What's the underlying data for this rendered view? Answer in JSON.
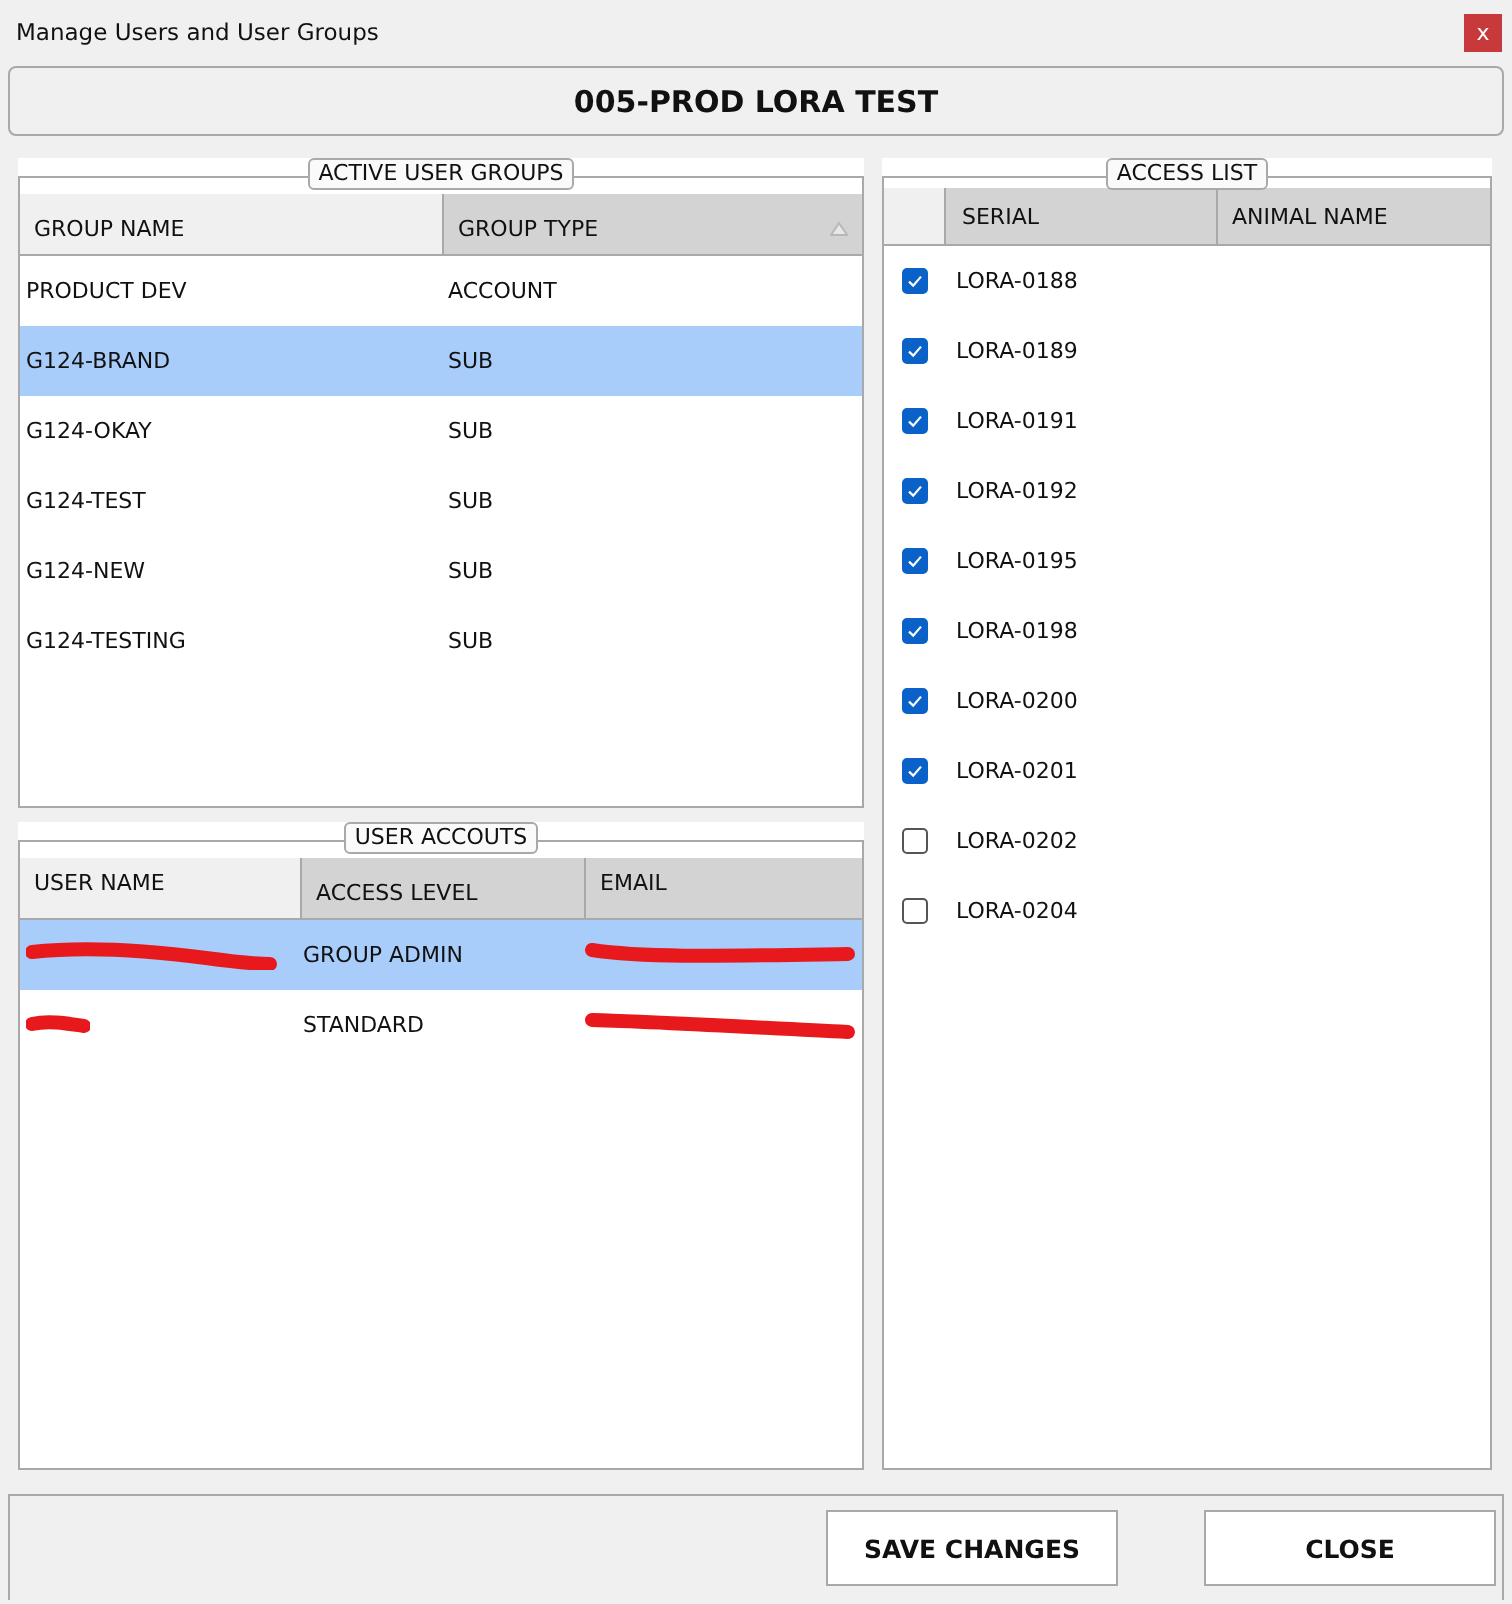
{
  "window": {
    "title": "Manage Users and User Groups",
    "close": "x"
  },
  "heading": "005-PROD LORA TEST",
  "groups": {
    "legend": "ACTIVE USER GROUPS",
    "columns": [
      {
        "label": "GROUP NAME",
        "shaded": false,
        "sorted": false
      },
      {
        "label": "GROUP TYPE",
        "shaded": true,
        "sorted": true
      }
    ],
    "rows": [
      {
        "name": "PRODUCT DEV",
        "type": "ACCOUNT",
        "selected": false
      },
      {
        "name": "G124-BRAND",
        "type": "SUB",
        "selected": true
      },
      {
        "name": "G124-OKAY",
        "type": "SUB",
        "selected": false
      },
      {
        "name": "G124-TEST",
        "type": "SUB",
        "selected": false
      },
      {
        "name": "G124-NEW",
        "type": "SUB",
        "selected": false
      },
      {
        "name": "G124-TESTING",
        "type": "SUB",
        "selected": false
      }
    ]
  },
  "users": {
    "legend": "USER ACCOUTS",
    "columns": [
      {
        "label": "USER NAME",
        "shaded": false
      },
      {
        "label": "ACCESS LEVEL",
        "shaded": true
      },
      {
        "label": "EMAIL",
        "shaded": true
      }
    ],
    "rows": [
      {
        "access_level": "GROUP ADMIN",
        "selected": true,
        "redacted": true
      },
      {
        "access_level": "STANDARD",
        "selected": false,
        "redacted": true
      }
    ]
  },
  "access": {
    "legend": "ACCESS LIST",
    "columns": [
      {
        "label": "SERIAL",
        "shaded": true
      },
      {
        "label": "ANIMAL NAME",
        "shaded": true
      }
    ],
    "rows": [
      {
        "serial": "LORA-0188",
        "checked": true
      },
      {
        "serial": "LORA-0189",
        "checked": true
      },
      {
        "serial": "LORA-0191",
        "checked": true
      },
      {
        "serial": "LORA-0192",
        "checked": true
      },
      {
        "serial": "LORA-0195",
        "checked": true
      },
      {
        "serial": "LORA-0198",
        "checked": true
      },
      {
        "serial": "LORA-0200",
        "checked": true
      },
      {
        "serial": "LORA-0201",
        "checked": true
      },
      {
        "serial": "LORA-0202",
        "checked": false
      },
      {
        "serial": "LORA-0204",
        "checked": false
      }
    ]
  },
  "buttons": [
    {
      "label": "SAVE CHANGES"
    },
    {
      "label": "CLOSE"
    }
  ]
}
